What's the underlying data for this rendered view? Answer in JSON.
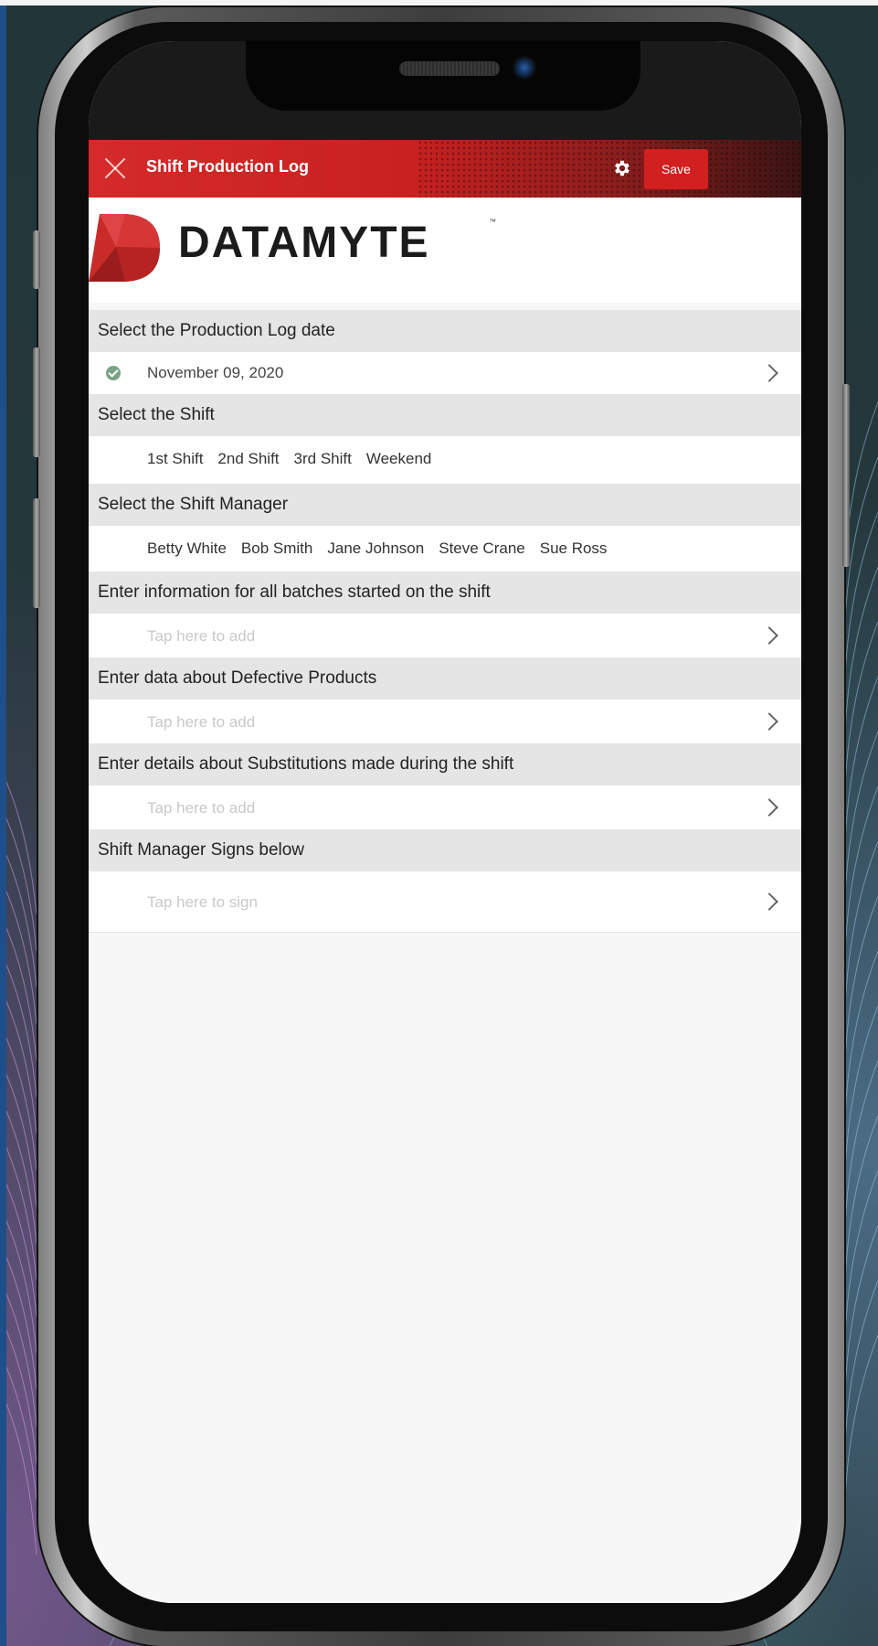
{
  "app": {
    "title": "Shift Production Log",
    "save_label": "Save",
    "logo_text": "DATAMYTE",
    "logo_tm": "™",
    "brand_color": "#d21f1f"
  },
  "form": {
    "date_section": {
      "label": "Select the Production Log date",
      "value": "November 09, 2020",
      "status_icon": "check-circle-icon"
    },
    "shift_section": {
      "label": "Select the Shift",
      "options": [
        "1st Shift",
        "2nd Shift",
        "3rd Shift",
        "Weekend"
      ]
    },
    "manager_section": {
      "label": "Select the Shift Manager",
      "options": [
        "Betty White",
        "Bob Smith",
        "Jane Johnson",
        "Steve Crane",
        "Sue Ross"
      ]
    },
    "batches_section": {
      "label": "Enter information for all batches started on the shift",
      "placeholder": "Tap here to add"
    },
    "defects_section": {
      "label": "Enter data about Defective Products",
      "placeholder": "Tap here to add"
    },
    "substitutions_section": {
      "label": "Enter details about Substitutions made during the shift",
      "placeholder": "Tap here to add"
    },
    "signature_section": {
      "label": "Shift Manager Signs below",
      "placeholder": "Tap here to sign"
    }
  }
}
